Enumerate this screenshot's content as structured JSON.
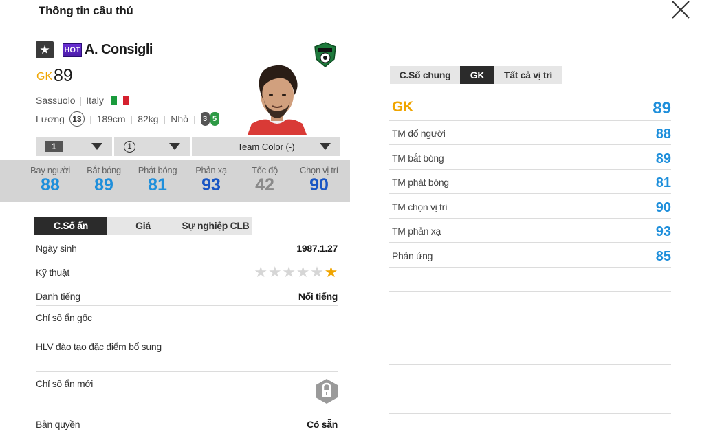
{
  "dialog": {
    "title": "Thông tin cầu thủ",
    "close_icon": "close-icon"
  },
  "player": {
    "hot_badge": "HOT",
    "name": "A. Consigli",
    "position": "GK",
    "ovr": "89",
    "club": "Sassuolo",
    "nation": "Italy",
    "salary_label": "Lương",
    "salary": "13",
    "height": "189cm",
    "weight": "82kg",
    "body": "Nhỏ",
    "weak_foot": "3",
    "strong_foot": "5",
    "colors": {
      "gold": "#f0a500",
      "blue": "#1f8fdb",
      "dark_blue": "#1a56c4",
      "grey": "#8a8a8a"
    }
  },
  "selectors": {
    "level": "1",
    "training": "1",
    "team_color": "Team Color (-)"
  },
  "main_stats": [
    {
      "label": "Bay người",
      "value": "88",
      "color": "#1f8fdb"
    },
    {
      "label": "Bắt bóng",
      "value": "89",
      "color": "#1f8fdb"
    },
    {
      "label": "Phát bóng",
      "value": "81",
      "color": "#1f8fdb"
    },
    {
      "label": "Phản xạ",
      "value": "93",
      "color": "#1a56c4"
    },
    {
      "label": "Tốc độ",
      "value": "42",
      "color": "#8a8a8a"
    },
    {
      "label": "Chọn vị trí",
      "value": "90",
      "color": "#1a56c4"
    }
  ],
  "left_tabs": [
    "C.Số ẩn",
    "Giá",
    "Sự nghiệp CLB"
  ],
  "info": {
    "birth_label": "Ngày sinh",
    "birth": "1987.1.27",
    "skill_label": "Kỹ thuật",
    "skill_stars": 1,
    "skill_max": 6,
    "rep_label": "Danh tiếng",
    "rep": "Nổi tiếng",
    "hidden_orig_label": "Chỉ số ẩn gốc",
    "coach_label": "HLV đào tạo đặc điểm bổ sung",
    "new_hidden_label": "Chỉ số ẩn mới",
    "license_label": "Bản quyền",
    "license": "Có sẵn"
  },
  "right_tabs": [
    "C.Số chung",
    "GK",
    "Tất cả vị trí"
  ],
  "right_panel": {
    "header_label": "GK",
    "header_value": "89",
    "rows": [
      {
        "label": "TM đổ người",
        "value": "88"
      },
      {
        "label": "TM bắt bóng",
        "value": "89"
      },
      {
        "label": "TM phát bóng",
        "value": "81"
      },
      {
        "label": "TM chọn vị trí",
        "value": "90"
      },
      {
        "label": "TM phản xạ",
        "value": "93"
      },
      {
        "label": "Phản ứng",
        "value": "85"
      }
    ]
  }
}
